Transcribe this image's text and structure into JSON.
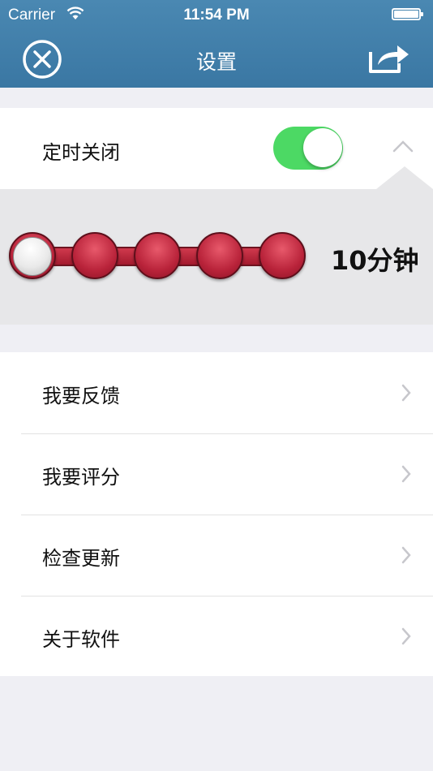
{
  "status_bar": {
    "carrier": "Carrier",
    "time": "11:54 PM"
  },
  "header": {
    "title": "设置",
    "close_icon": "close-circle-icon",
    "share_icon": "share-icon"
  },
  "timer": {
    "label": "定时关闭",
    "enabled": true,
    "slider_value": "10分钟",
    "slider_positions": 5,
    "selected_index": 0
  },
  "menu": {
    "items": [
      {
        "label": "我要反馈"
      },
      {
        "label": "我要评分"
      },
      {
        "label": "检查更新"
      },
      {
        "label": "关于软件"
      }
    ]
  },
  "colors": {
    "header": "#3d7ba6",
    "toggle_on": "#4cd964",
    "slider": "#c92a40"
  }
}
